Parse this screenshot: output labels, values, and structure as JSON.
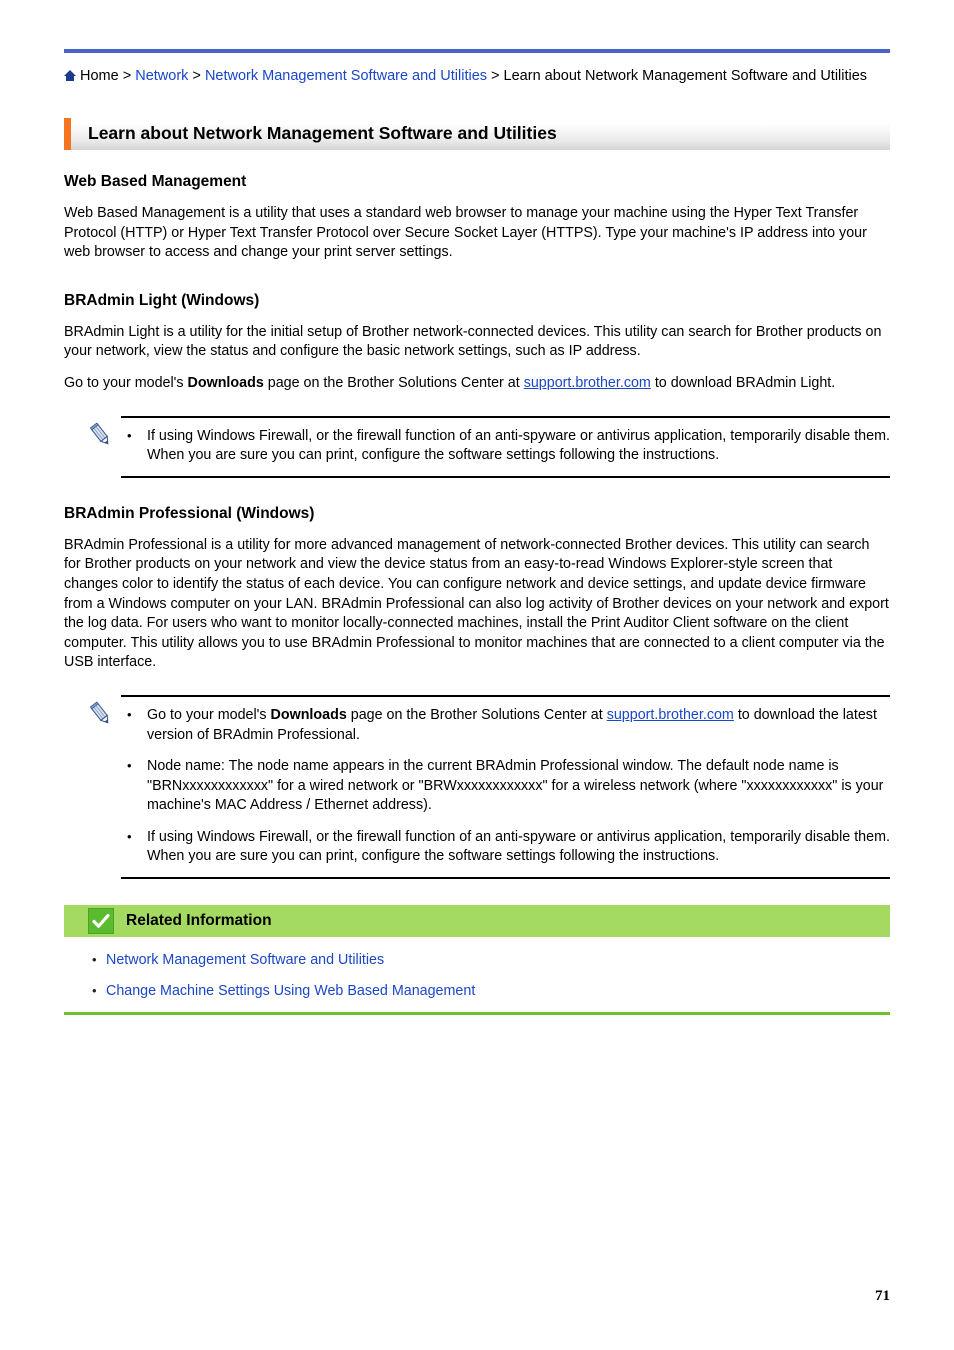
{
  "document": {
    "page_number": "71"
  },
  "colors": {
    "top_rule": "#4a63c8",
    "link": "#1a46c8",
    "title_accent": "#f4741f",
    "related_header_bg": "#a4da62",
    "related_check_bg": "#5bbb2e",
    "related_footer_rule": "#6fc02c"
  },
  "breadcrumb": {
    "home_icon": "home-icon",
    "home_label": "Home",
    "separator": " > ",
    "items": [
      {
        "label": "Home",
        "is_link": false
      },
      {
        "label": "Network",
        "is_link": true
      },
      {
        "label": "Network Management Software and Utilities",
        "is_link": true
      },
      {
        "label": "Learn about Network Management Software and Utilities",
        "is_link": false
      }
    ]
  },
  "page_title": "Learn about Network Management Software and Utilities",
  "sections": {
    "web_based_management": {
      "heading": "Web Based Management",
      "paragraph": "Web Based Management is a utility that uses a standard web browser to manage your machine using the Hyper Text Transfer Protocol (HTTP) or Hyper Text Transfer Protocol over Secure Socket Layer (HTTPS). Type your machine's IP address into your web browser to access and change your print server settings."
    },
    "bradmin_light": {
      "heading": "BRAdmin Light (Windows)",
      "paragraph_1": "BRAdmin Light is a utility for the initial setup of Brother network-connected devices. This utility can search for Brother products on your network, view the status and configure the basic network settings, such as IP address.",
      "paragraph_2_part_1": "Go to your model's ",
      "paragraph_2_bold": "Downloads",
      "paragraph_2_part_2": " page on the Brother Solutions Center at ",
      "paragraph_2_link": "support.brother.com",
      "paragraph_2_part_3": " to download BRAdmin Light."
    },
    "note_1": {
      "icon": "pencil-icon",
      "bullets": [
        "If using Windows Firewall, or the firewall function of an anti-spyware or antivirus application, temporarily disable them. When you are sure you can print, configure the software settings following the instructions."
      ]
    },
    "bradmin_professional": {
      "heading": "BRAdmin Professional (Windows)",
      "paragraph": "BRAdmin Professional is a utility for more advanced management of network-connected Brother devices. This utility can search for Brother products on your network and view the device status from an easy-to-read Windows Explorer-style screen that changes color to identify the status of each device. You can configure network and device settings, and update device firmware from a Windows computer on your LAN. BRAdmin Professional can also log activity of Brother devices on your network and export the log data. For users who want to monitor locally-connected machines, install the Print Auditor Client software on the client computer. This utility allows you to use BRAdmin Professional to monitor machines that are connected to a client computer via the USB interface."
    },
    "note_2": {
      "icon": "pencil-icon",
      "bullet_1_part_1": "Go to your model's ",
      "bullet_1_bold": "Downloads",
      "bullet_1_part_2": " page on the Brother Solutions Center at ",
      "bullet_1_link": "support.brother.com",
      "bullet_1_part_3": " to download the latest version of BRAdmin Professional.",
      "bullet_2": "Node name: The node name appears in the current BRAdmin Professional window. The default node name is \"BRNxxxxxxxxxxxx\" for a wired network or \"BRWxxxxxxxxxxxx\" for a wireless network (where \"xxxxxxxxxxxx\" is your machine's MAC Address / Ethernet address).",
      "bullet_3": "If using Windows Firewall, or the firewall function of an anti-spyware or antivirus application, temporarily disable them. When you are sure you can print, configure the software settings following the instructions."
    },
    "related_information": {
      "icon": "check-icon",
      "heading": "Related Information",
      "links": [
        "Network Management Software and Utilities",
        "Change Machine Settings Using Web Based Management"
      ]
    }
  }
}
